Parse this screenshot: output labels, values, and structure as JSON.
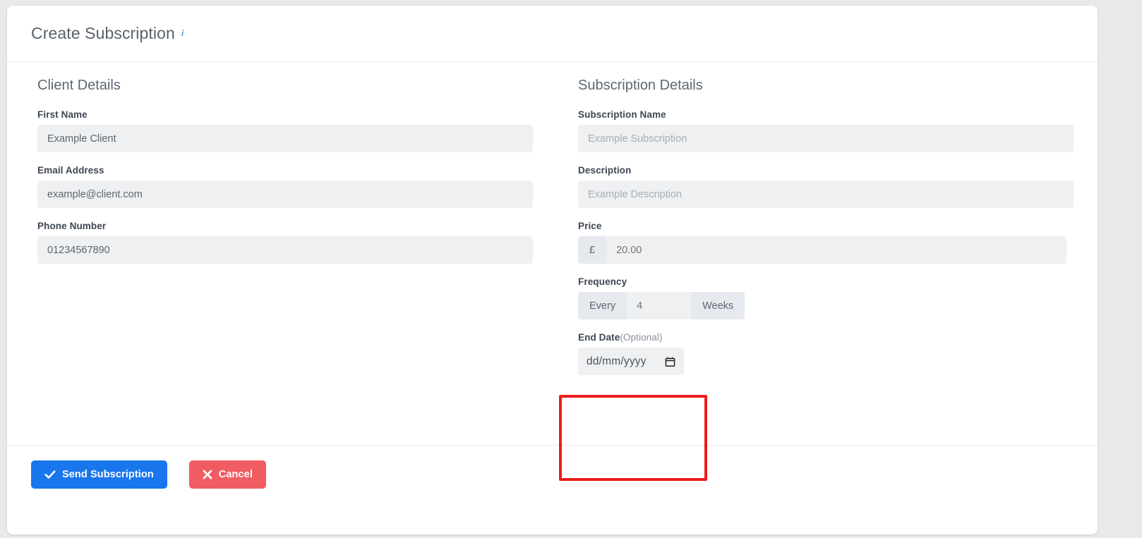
{
  "header": {
    "title": "Create Subscription",
    "info_icon": "info-icon",
    "info_glyph": "i"
  },
  "client_section": {
    "heading": "Client Details",
    "fields": [
      {
        "label": "First Name",
        "value": "Example Client",
        "placeholder": "First Name"
      },
      {
        "label": "Email Address",
        "value": "example@client.com",
        "placeholder": "Email Address"
      },
      {
        "label": "Phone Number",
        "value": "01234567890",
        "placeholder": "Phone Number"
      }
    ]
  },
  "subscription_section": {
    "heading": "Subscription Details",
    "name_field": {
      "label": "Subscription Name",
      "value": "",
      "placeholder": "Example Subscription"
    },
    "description_field": {
      "label": "Description",
      "value": "",
      "placeholder": "Example Description"
    },
    "price_field": {
      "label": "Price",
      "currency_symbol": "£",
      "value": "",
      "placeholder": "20.00"
    },
    "frequency_field": {
      "label": "Frequency",
      "prefix": "Every",
      "value": "",
      "placeholder": "4",
      "suffix": "Weeks"
    },
    "end_date_field": {
      "label": "End Date",
      "optional_suffix": "(Optional)",
      "value": "",
      "display": "dd/mm/yyyy",
      "picker_icon": "calendar-icon"
    }
  },
  "footer": {
    "submit_label": "Send Subscription",
    "submit_icon": "check-icon",
    "cancel_label": "Cancel",
    "cancel_icon": "x-icon"
  },
  "colors": {
    "primary": "#1976ed",
    "danger": "#f15b62",
    "highlight": "#ee1c1c",
    "input_bg": "#eef0f2",
    "addon_bg": "#e6eaee",
    "label": "#3d4752",
    "heading": "#5d6771"
  }
}
